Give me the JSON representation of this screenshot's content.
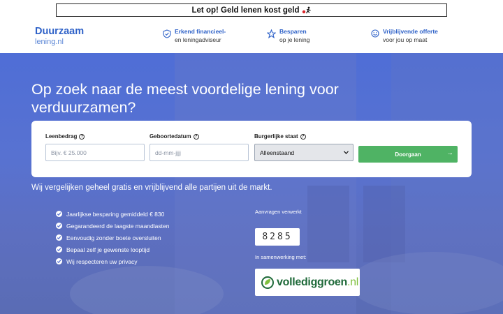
{
  "warning": {
    "text": "Let op! Geld lenen kost geld"
  },
  "header": {
    "logo_main": "Duurzaam",
    "logo_sub": "lening.nl",
    "usps": [
      {
        "icon": "shield-check-icon",
        "line1": "Erkend financieel-",
        "line2": "en leningadviseur"
      },
      {
        "icon": "star-icon",
        "line1": "Besparen",
        "line2": "op je lening"
      },
      {
        "icon": "smiley-icon",
        "line1": "Vrijblijvende offerte",
        "line2": "voor jou op maat"
      }
    ]
  },
  "hero": {
    "title": "Op zoek naar de meest voordelige lening voor verduurzamen?",
    "form": {
      "amount_label": "Leenbedrag",
      "amount_placeholder": "Bijv. € 25.000",
      "birthdate_label": "Geboortedatum",
      "birthdate_placeholder": "dd-mm-jjjj",
      "status_label": "Burgerlijke staat",
      "status_value": "Alleenstaand",
      "submit_label": "Doorgaan"
    },
    "compare_text": "Wij vergelijken geheel gratis en vrijblijvend alle partijen uit de markt.",
    "benefits": [
      "Jaarlijkse besparing gemiddeld € 830",
      "Gegarandeerd de laagste maandlasten",
      "Eenvoudig zonder boete oversluiten",
      "Bepaal zelf je gewenste looptijd",
      "Wij respecteren uw privacy"
    ],
    "requests_label": "Aanvragen verwerkt",
    "requests_count": "8285",
    "partner_label": "In samenwerking met:",
    "partner_name": "volledig groen",
    "partner_tld": ".nl"
  },
  "colors": {
    "brand": "#2f62c8",
    "hero": "#5872d1",
    "cta": "#4fb364",
    "partner_green": "#1f6a3a"
  }
}
